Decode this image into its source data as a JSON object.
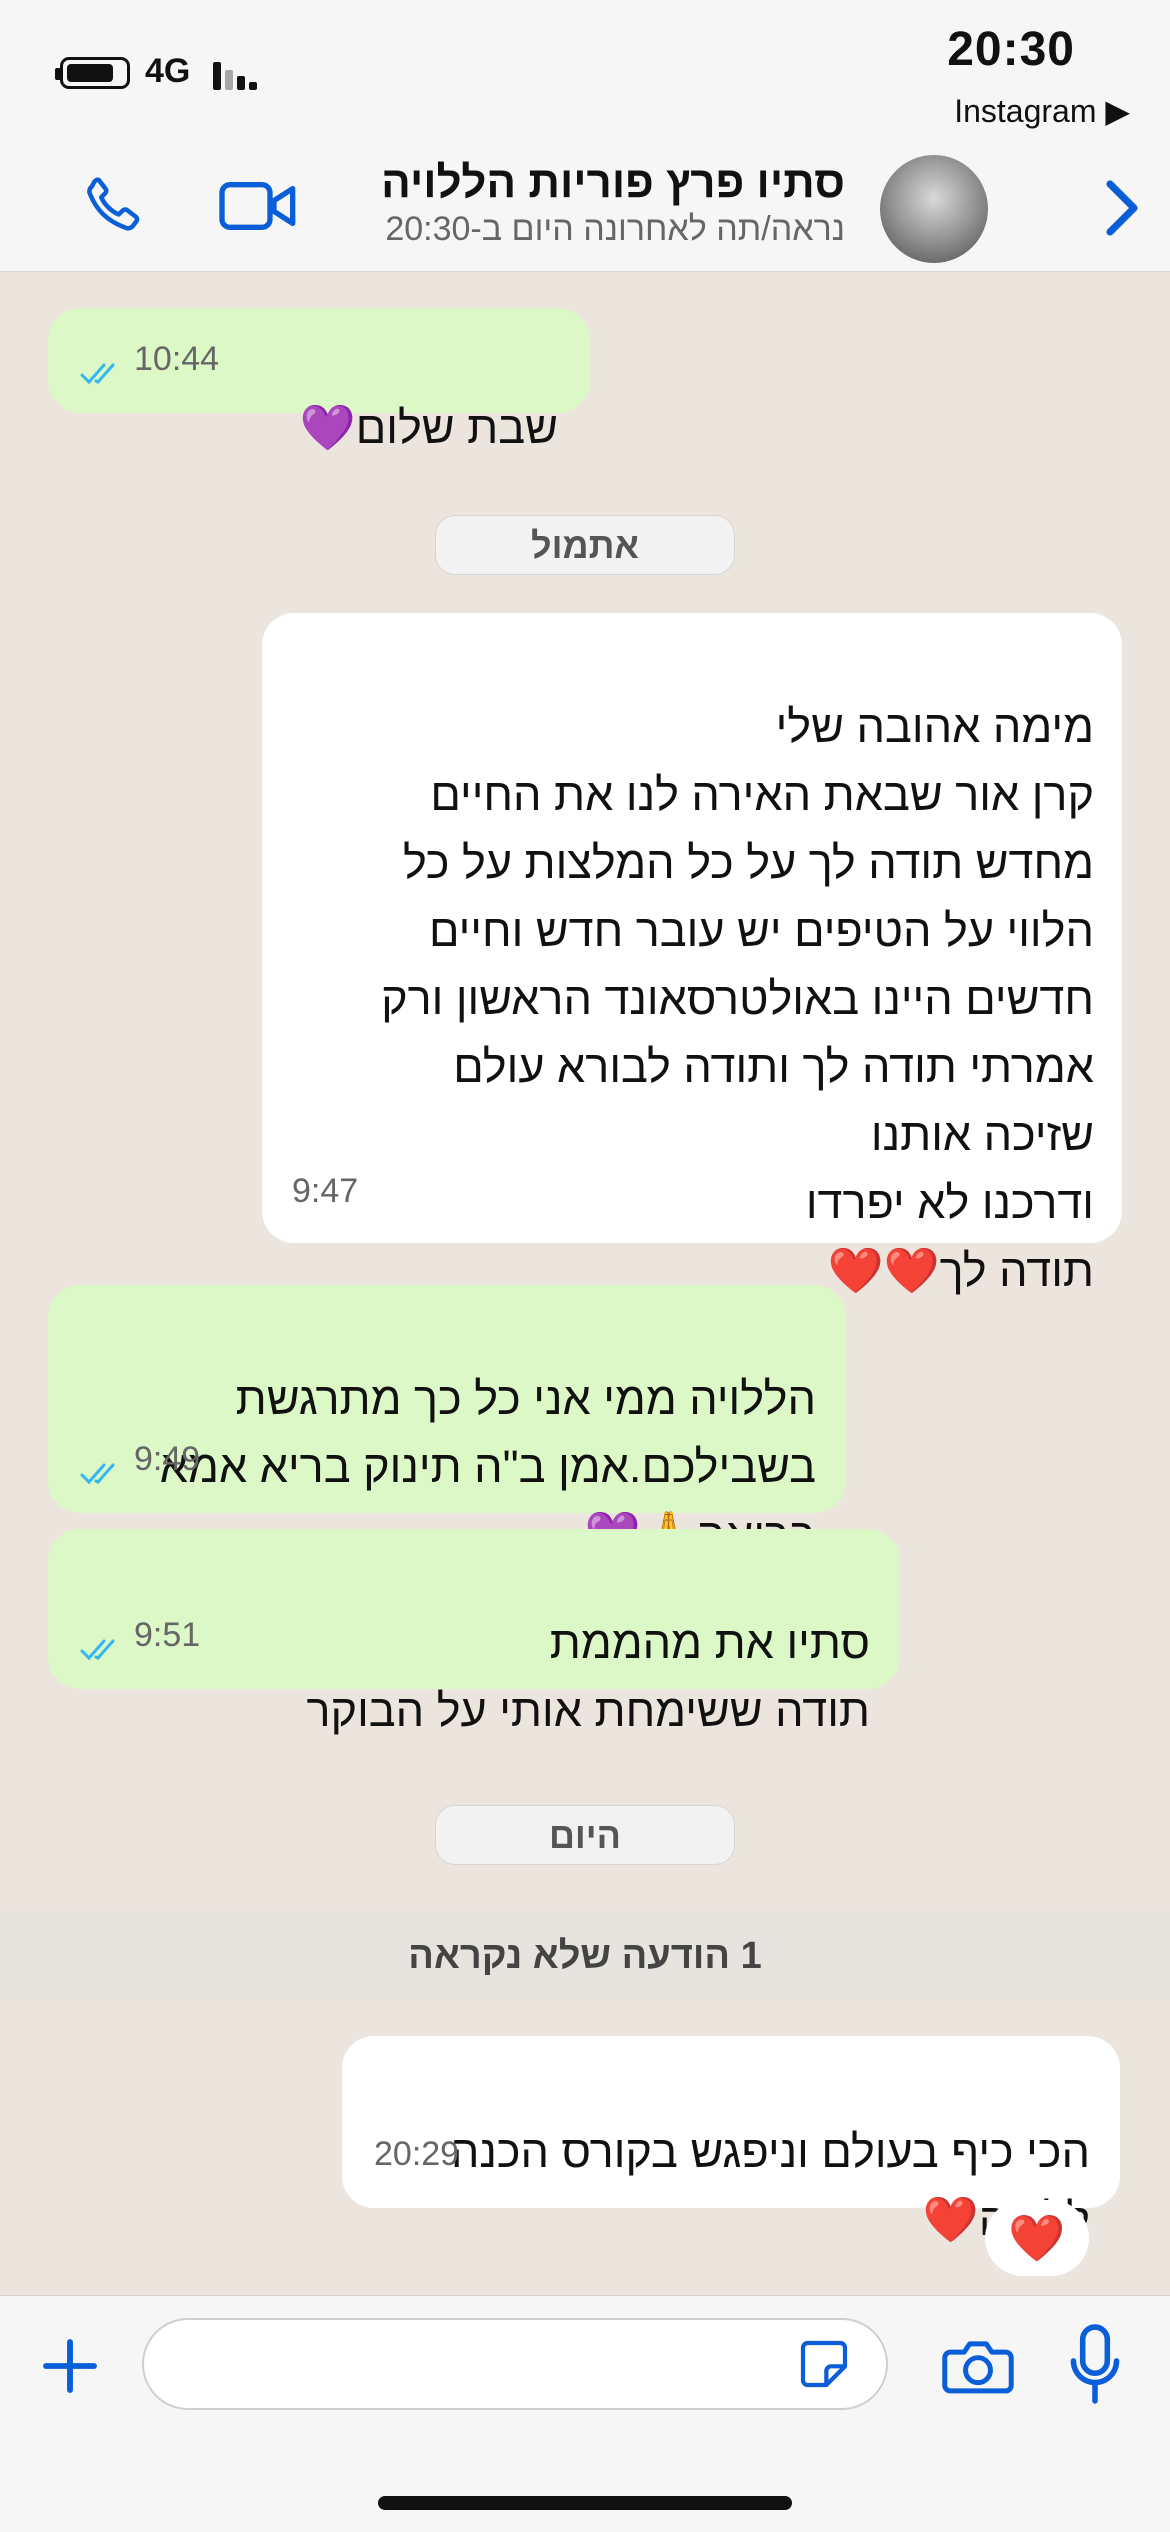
{
  "status_bar": {
    "time": "20:30",
    "back_app": "Instagram ▶",
    "network": "4G"
  },
  "header": {
    "contact_name": "סתיו פרץ  פוריות הללויה",
    "last_seen": "נראה/תה לאחרונה היום ב-20:30",
    "icons": [
      "back-chevron-icon",
      "avatar",
      "video-call-icon",
      "phone-call-icon"
    ],
    "accent_color": "#0a5ed8"
  },
  "messages": [
    {
      "dir": "out",
      "text": "שבת שלום💜",
      "time": "10:44",
      "read": true
    },
    {
      "dir": "chip",
      "text": "אתמול"
    },
    {
      "dir": "in",
      "text": "מימה אהובה שלי\nקרן אור שבאת האירה לנו את החיים\nמחדש תודה לך על כל המלצות על כל\nהלווי על הטיפים יש עובר חדש וחיים\nחדשים היינו באולטרסאונד הראשון ורק\nאמרתי תודה לך ותודה לבורא עולם\nשזיכה אותנו\nודרכנו לא יפרדו\nתודה לך❤️❤️",
      "time": "9:47"
    },
    {
      "dir": "out",
      "text": "הללויה ממי אני כל כך מתרגשת\nבשבילכם.אמן ב\"ה תינוק בריא אמא\nבריאה🙏💜",
      "time": "9:49",
      "read": true
    },
    {
      "dir": "out",
      "text": "סתיו את מהממת\nתודה ששימחת אותי על הבוקר",
      "time": "9:51",
      "read": true
    },
    {
      "dir": "chip",
      "text": "היום"
    },
    {
      "dir": "unread",
      "text": "1 הודעה שלא נקראה"
    },
    {
      "dir": "in",
      "text": "הכי כיף בעולם וניפגש בקורס הכנה\nללידה❤️",
      "time": "20:29",
      "reaction": "❤️"
    }
  ],
  "input_bar": {
    "placeholder": "",
    "icons": [
      "plus-icon",
      "sticker-icon",
      "camera-icon",
      "microphone-icon"
    ]
  },
  "colors": {
    "outgoing_bubble": "#dcf8c6",
    "incoming_bubble": "#ffffff",
    "chat_background": "#ece5dd",
    "read_ticks": "#34b7f1"
  }
}
